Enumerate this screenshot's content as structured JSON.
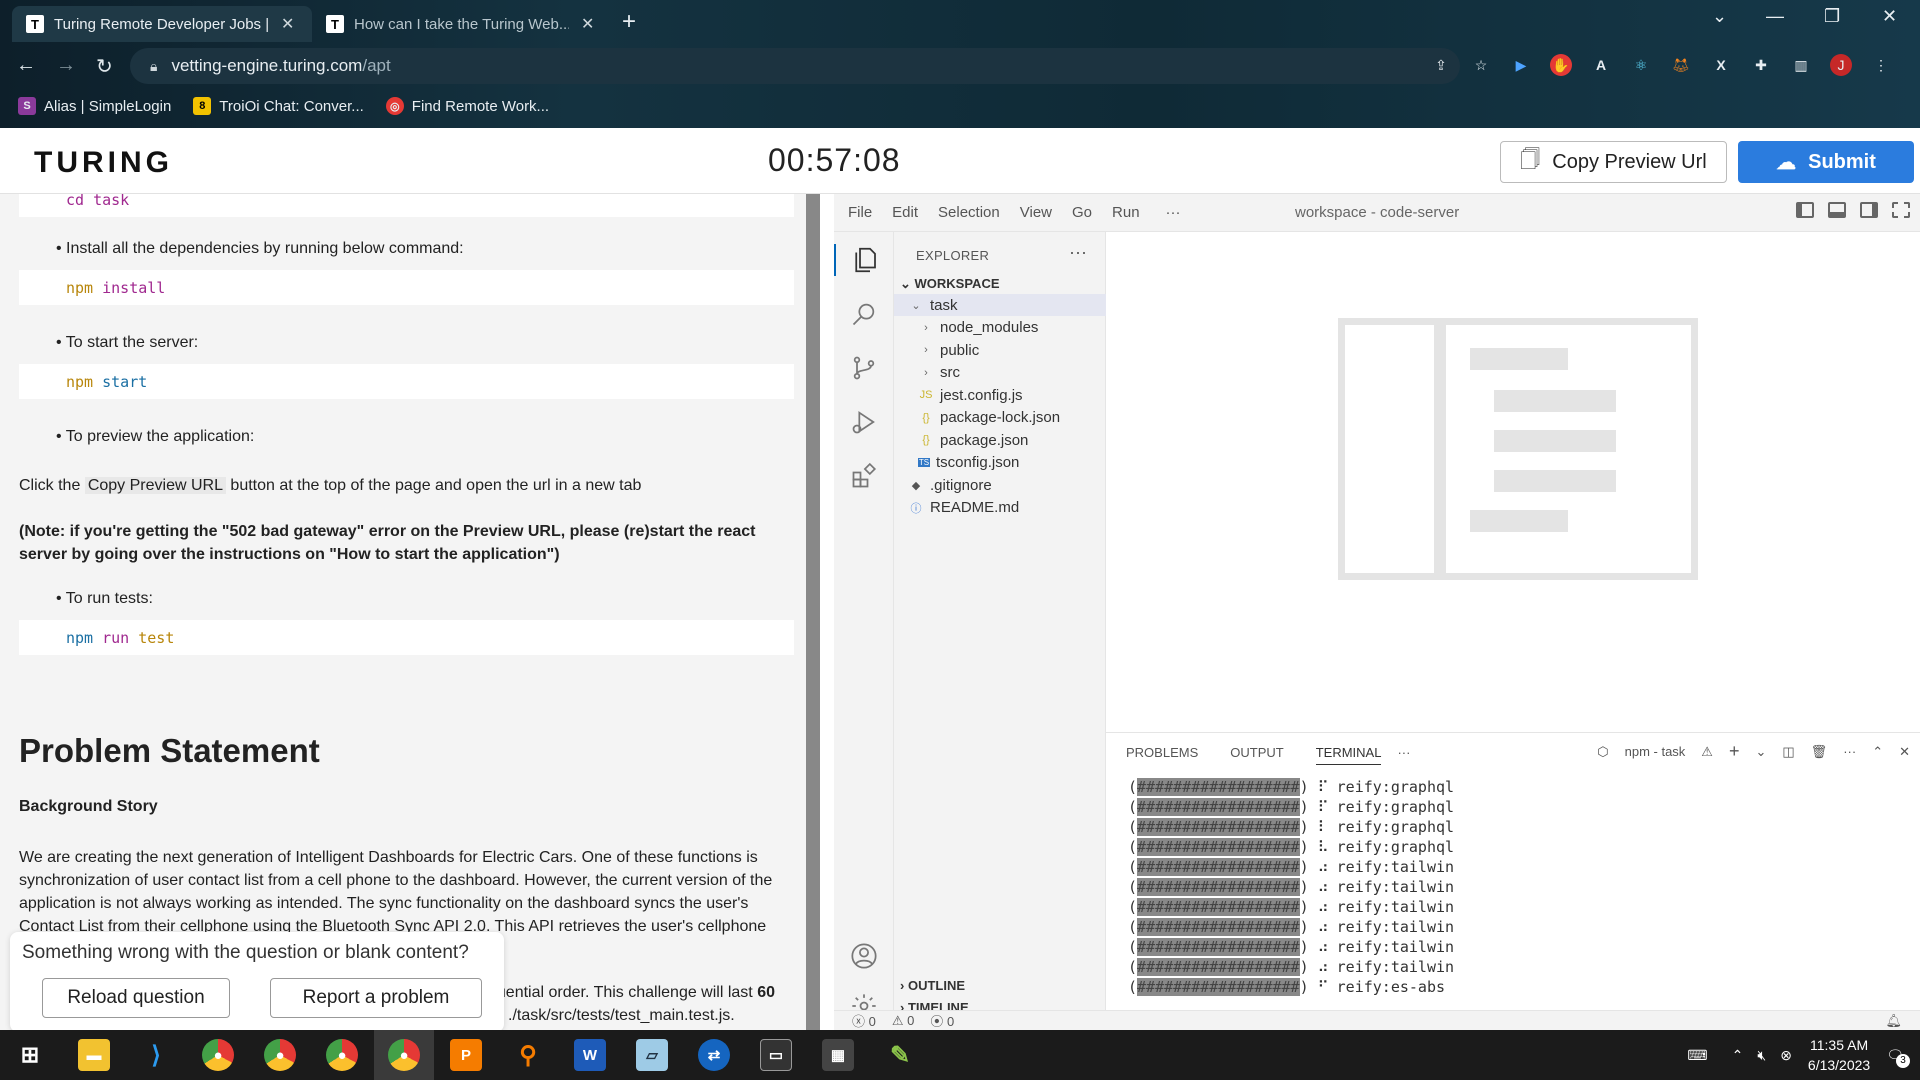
{
  "browser": {
    "tabs": [
      {
        "title": "Turing Remote Developer Jobs | ...",
        "active": true
      },
      {
        "title": "How can I take the Turing Web...",
        "active": false
      }
    ],
    "url_host": "vetting-engine.turing.com",
    "url_path": "/apt",
    "profile_initial": "J",
    "bookmarks": [
      {
        "label": "Alias | SimpleLogin"
      },
      {
        "label": "TroiOi Chat: Conver..."
      },
      {
        "label": "Find Remote Work..."
      }
    ]
  },
  "header": {
    "logo": "TURING",
    "timer": "00:57:08",
    "copy_preview_label": "Copy Preview Url",
    "submit_label": "Submit"
  },
  "instructions": {
    "partial_top": "cd task",
    "bullet_install": "• Install all the dependencies by running below command:",
    "code_install_cmd": "npm",
    "code_install_arg": "install",
    "bullet_start": "• To start the server:",
    "code_start_cmd": "npm",
    "code_start_arg": "start",
    "bullet_preview": "• To preview the application:",
    "preview_text_before": "Click the",
    "preview_text_code": "Copy Preview URL",
    "preview_text_after": "button at the top of the page and open the url in a new tab",
    "note": "(Note: if you're getting the \"502 bad gateway\" error on the Preview URL, please (re)start the react server by going over the instructions on \"How to start the application\")",
    "bullet_tests": "• To run tests:",
    "code_tests_cmd": "npm",
    "code_tests_run": "run",
    "code_tests_arg": "test",
    "heading": "Problem Statement",
    "subheading": "Background Story",
    "story": "We are creating the next generation of Intelligent Dashboards for Electric Cars. One of these functions is synchronization of user contact list from a cell phone to the dashboard. However, the current version of the application is not always working as intended. The sync functionality on the dashboard syncs the user's Contact List from their cellphone using the Bluetooth Sync API 2.0. This API retrieves the user's cellphone",
    "partial_bottom_1": "quential order. This challenge will last",
    "partial_bottom_bold": "60",
    "partial_bottom_2": "./task/src/tests/test_main.test.js."
  },
  "feedback": {
    "question": "Something wrong with the question or blank content?",
    "reload_label": "Reload question",
    "report_label": "Report a problem"
  },
  "vscode": {
    "menu": [
      "File",
      "Edit",
      "Selection",
      "View",
      "Go",
      "Run",
      "···"
    ],
    "title": "workspace - code-server",
    "explorer_title": "EXPLORER",
    "workspace_label": "WORKSPACE",
    "tree": [
      {
        "label": "task",
        "icon": "chevron-down",
        "indent": 1
      },
      {
        "label": "node_modules",
        "icon": "chevron-right",
        "indent": 2
      },
      {
        "label": "public",
        "icon": "chevron-right",
        "indent": 2
      },
      {
        "label": "src",
        "icon": "chevron-right",
        "indent": 2
      },
      {
        "label": "jest.config.js",
        "icon": "JS",
        "indent": 2
      },
      {
        "label": "package-lock.json",
        "icon": "{}",
        "indent": 2
      },
      {
        "label": "package.json",
        "icon": "{}",
        "indent": 2
      },
      {
        "label": "tsconfig.json",
        "icon": "TS",
        "indent": 2
      },
      {
        "label": ".gitignore",
        "icon": "◆",
        "indent": 1
      },
      {
        "label": "README.md",
        "icon": "ⓘ",
        "indent": 1
      }
    ],
    "outline_label": "OUTLINE",
    "timeline_label": "TIMELINE",
    "panel_tabs": [
      "PROBLEMS",
      "OUTPUT",
      "TERMINAL",
      "···"
    ],
    "active_panel_tab": "TERMINAL",
    "terminal_task": "npm - task",
    "terminal_lines": [
      {
        "bar": "##################",
        "spin": "⠏",
        "text": "reify:graphql"
      },
      {
        "bar": "##################",
        "spin": "⠏",
        "text": "reify:graphql"
      },
      {
        "bar": "##################",
        "spin": "⠇",
        "text": "reify:graphql"
      },
      {
        "bar": "##################",
        "spin": "⠧",
        "text": "reify:graphql"
      },
      {
        "bar": "##################",
        "spin": "⠴",
        "text": "reify:tailwin"
      },
      {
        "bar": "##################",
        "spin": "⠴",
        "text": "reify:tailwin"
      },
      {
        "bar": "##################",
        "spin": "⠴",
        "text": "reify:tailwin"
      },
      {
        "bar": "##################",
        "spin": "⠴",
        "text": "reify:tailwin"
      },
      {
        "bar": "##################",
        "spin": "⠴",
        "text": "reify:tailwin"
      },
      {
        "bar": "##################",
        "spin": "⠴",
        "text": "reify:tailwin"
      },
      {
        "bar": "##################",
        "spin": "⠋",
        "text": "reify:es-abs"
      }
    ],
    "status_errors": "0",
    "status_warnings": "0",
    "status_ports": "0"
  },
  "taskbar": {
    "time": "11:35 AM",
    "date": "6/13/2023",
    "notification_count": "3"
  }
}
